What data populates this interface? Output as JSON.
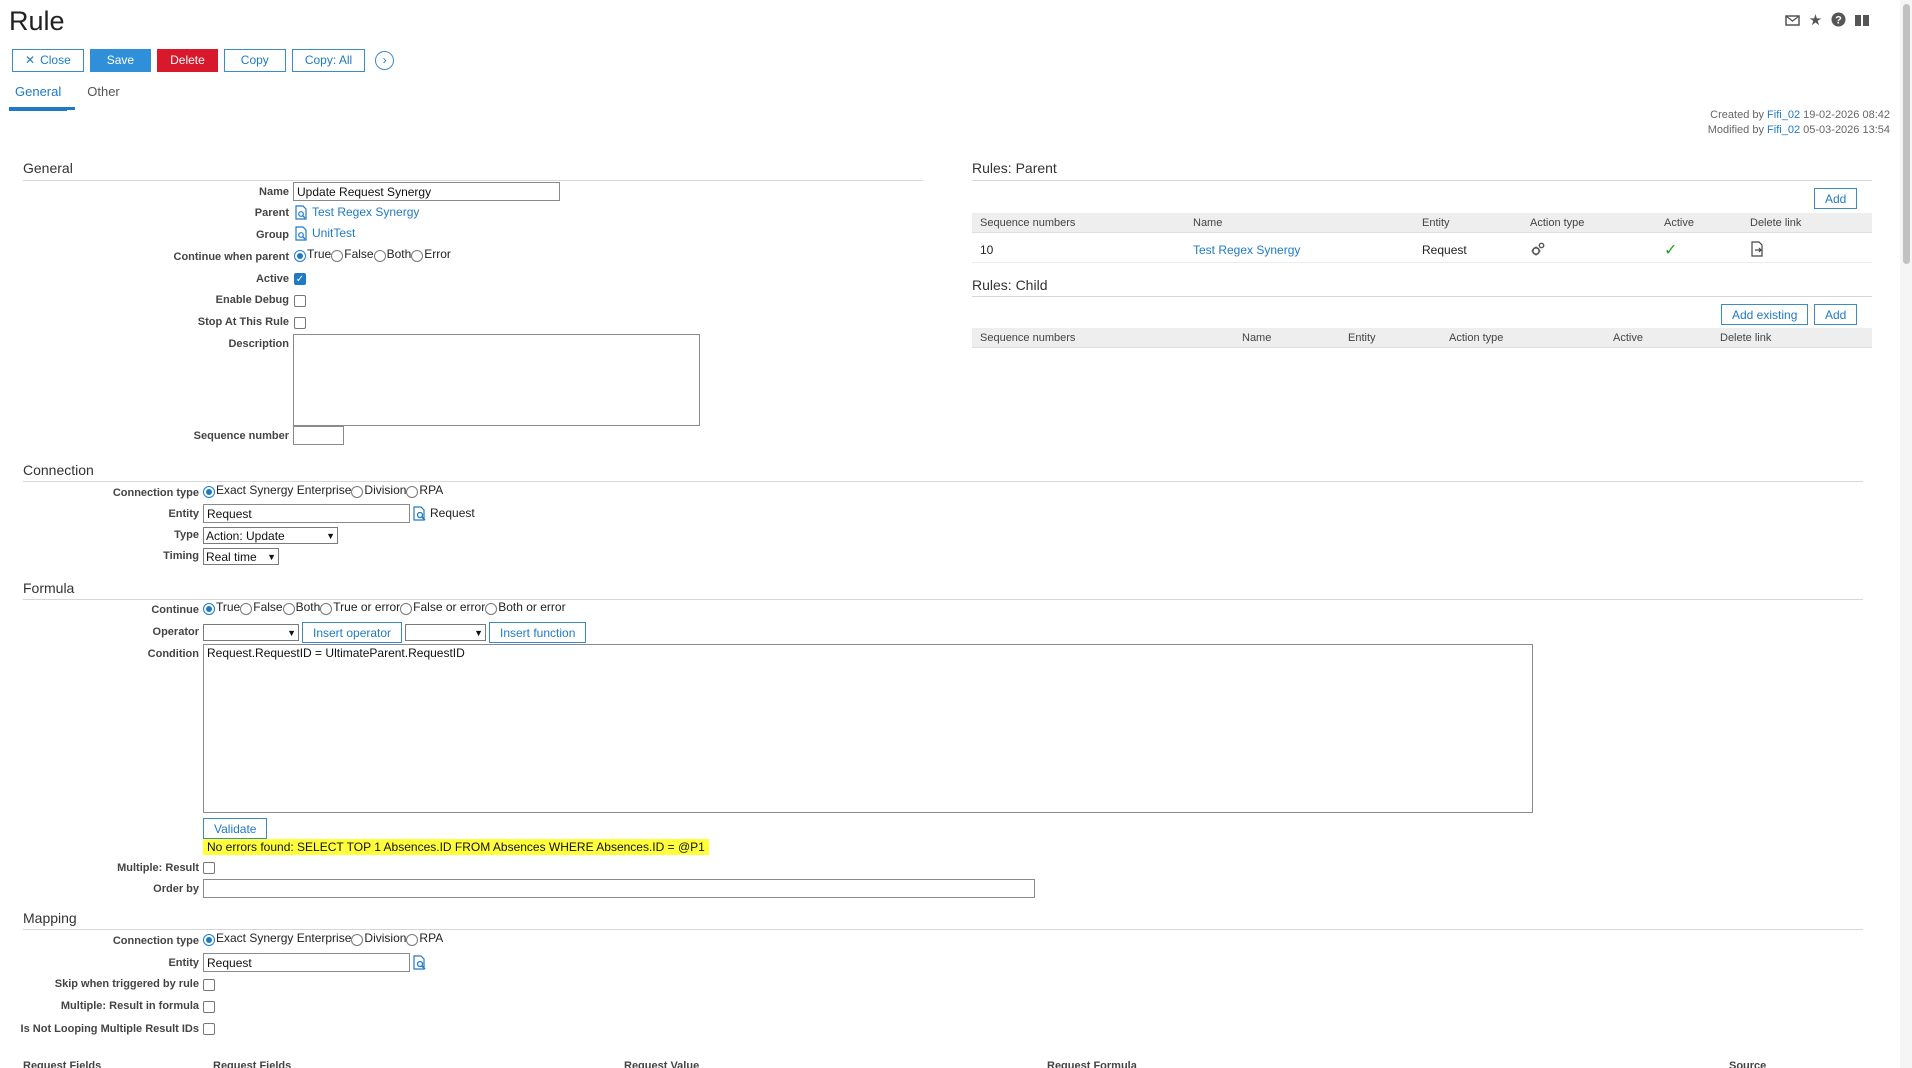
{
  "page": {
    "title": "Rule"
  },
  "toolbar": {
    "close_label": "Close",
    "save_label": "Save",
    "delete_label": "Delete",
    "copy_label": "Copy",
    "copy_all_label": "Copy: All"
  },
  "tabs": [
    {
      "label": "General"
    },
    {
      "label": "Other"
    }
  ],
  "meta": {
    "created_prefix": "Created by",
    "created_user": "Fifi_02",
    "created_date": "19-02-2026 08:42",
    "modified_prefix": "Modified by",
    "modified_user": "Fifi_02",
    "modified_date": "05-03-2026 13:54"
  },
  "general": {
    "title": "General",
    "name_label": "Name",
    "name_value": "Update Request Synergy",
    "parent_label": "Parent",
    "parent_value": "Test Regex Synergy",
    "group_label": "Group",
    "group_value": "UnitTest",
    "continue_label": "Continue when parent",
    "continue_options": [
      "True",
      "False",
      "Both",
      "Error"
    ],
    "active_label": "Active",
    "debug_label": "Enable Debug",
    "stop_label": "Stop At This Rule",
    "description_label": "Description",
    "description_value": "",
    "sequence_label": "Sequence number",
    "sequence_value": ""
  },
  "connection": {
    "title": "Connection",
    "type_label": "Connection type",
    "type_options": [
      "Exact Synergy Enterprise",
      "Division",
      "RPA"
    ],
    "entity_label": "Entity",
    "entity_value": "Request",
    "entity_text": "Request",
    "kind_label": "Type",
    "kind_value": "Action: Update",
    "timing_label": "Timing",
    "timing_value": "Real time"
  },
  "formula": {
    "title": "Formula",
    "continue_label": "Continue",
    "continue_options": [
      "True",
      "False",
      "Both",
      "True or error",
      "False or error",
      "Both or error"
    ],
    "operator_label": "Operator",
    "operator_value": "",
    "function_value": "",
    "insert_operator_label": "Insert operator",
    "insert_function_label": "Insert function",
    "condition_label": "Condition",
    "condition_value": "Request.RequestID = UltimateParent.RequestID",
    "validate_label": "Validate",
    "validation_message": "No errors found: SELECT TOP 1 Absences.ID FROM Absences WHERE Absences.ID = @P1",
    "multiple_label": "Multiple: Result",
    "orderby_label": "Order by",
    "orderby_value": ""
  },
  "mapping": {
    "title": "Mapping",
    "type_label": "Connection type",
    "type_options": [
      "Exact Synergy Enterprise",
      "Division",
      "RPA"
    ],
    "entity_label": "Entity",
    "entity_value": "Request",
    "skip_label": "Skip when triggered by rule",
    "multiple_formula_label": "Multiple: Result in formula",
    "notlooping_label": "Is Not Looping Multiple Result IDs",
    "columns": [
      "Request Fields",
      "Request Fields",
      "Request Value",
      "Request Formula",
      "Source"
    ]
  },
  "rules_parent": {
    "title": "Rules: Parent",
    "add_label": "Add",
    "columns": [
      "Sequence numbers",
      "Name",
      "Entity",
      "Action type",
      "Active",
      "Delete link"
    ],
    "rows": [
      {
        "seq": "10",
        "name": "Test Regex Synergy",
        "entity": "Request"
      }
    ]
  },
  "rules_child": {
    "title": "Rules: Child",
    "add_existing_label": "Add existing",
    "add_label": "Add",
    "columns": [
      "Sequence numbers",
      "Name",
      "Entity",
      "Action type",
      "Active",
      "Delete link"
    ]
  }
}
